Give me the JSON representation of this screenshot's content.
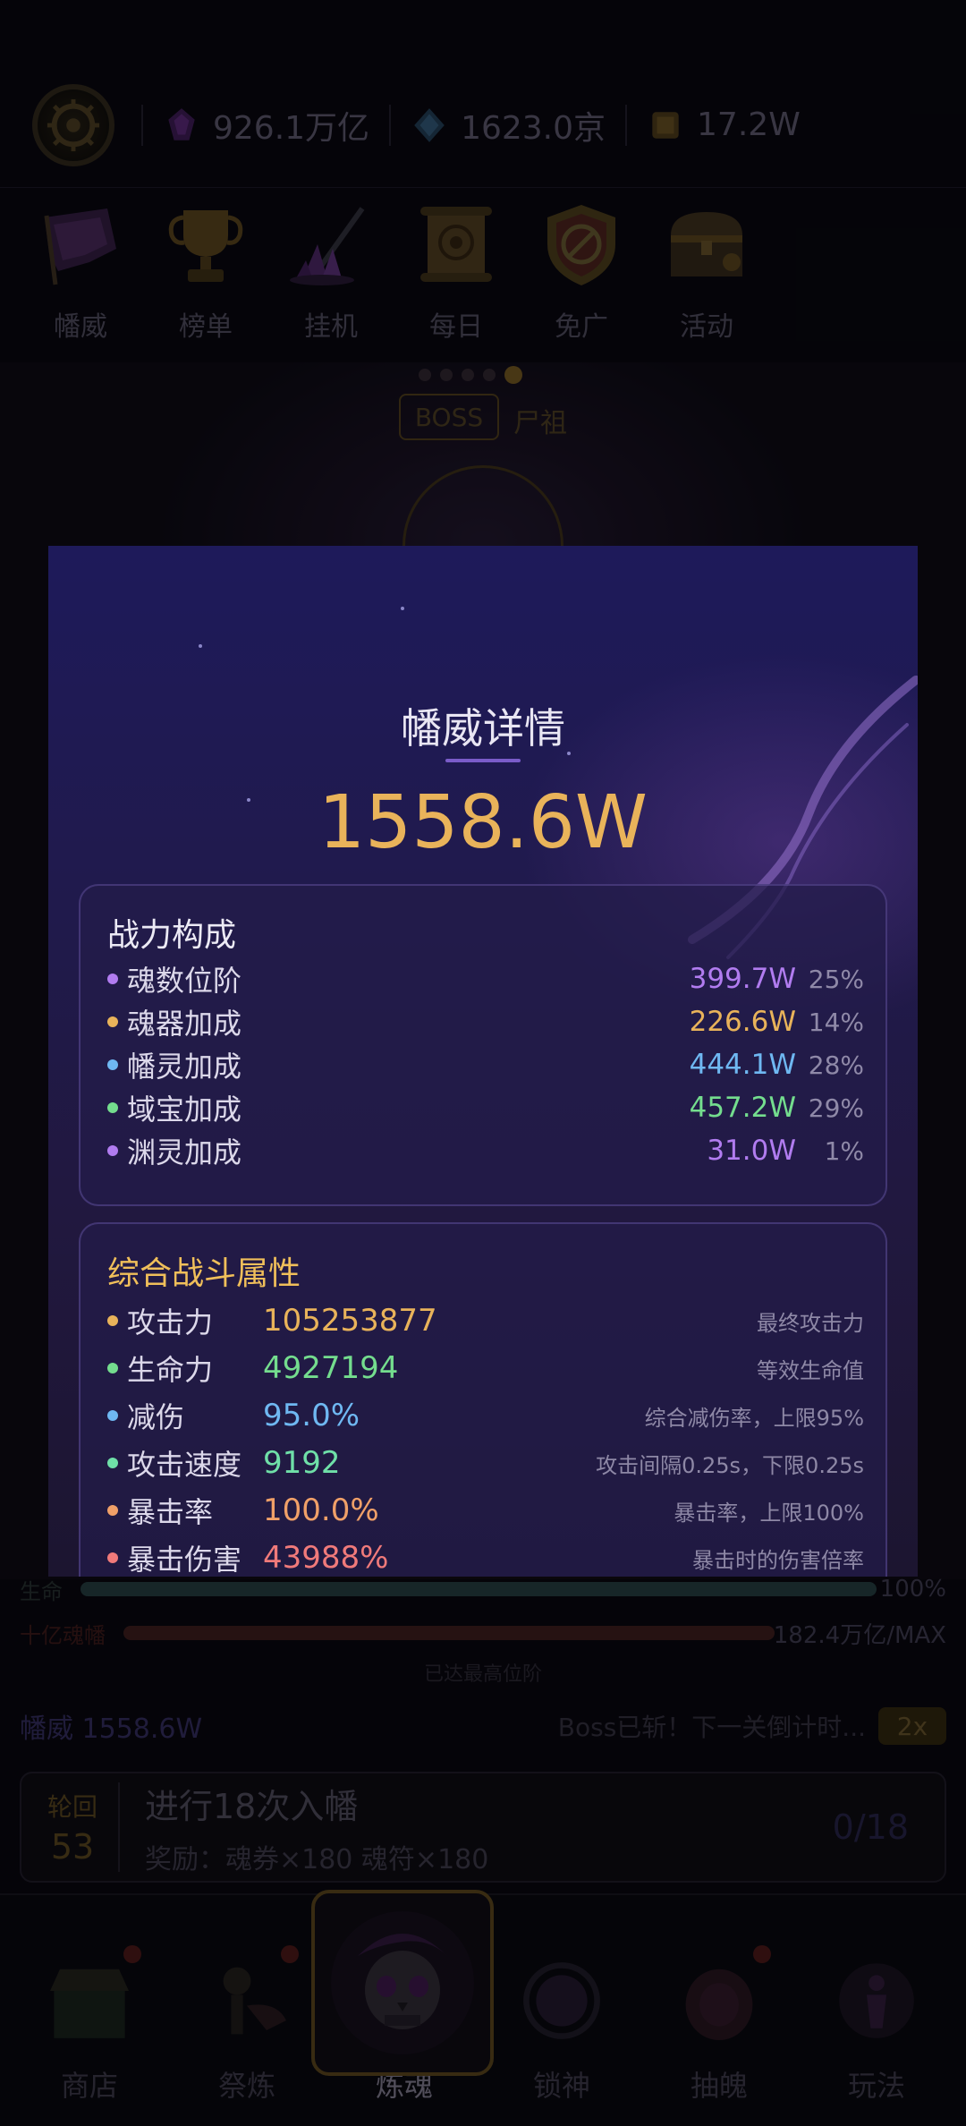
{
  "topbar": {
    "resources": [
      {
        "icon": "soul-gem-icon",
        "value": "926.1万亿"
      },
      {
        "icon": "blue-crystal-icon",
        "value": "1623.0京"
      },
      {
        "icon": "scroll-coin-icon",
        "value": "17.2W"
      }
    ]
  },
  "categories": [
    {
      "label": "幡威",
      "icon": "banner-icon"
    },
    {
      "label": "榜单",
      "icon": "trophy-icon"
    },
    {
      "label": "挂机",
      "icon": "crystal-sword-icon"
    },
    {
      "label": "每日",
      "icon": "scroll-icon"
    },
    {
      "label": "免广",
      "icon": "no-ads-shield-icon"
    },
    {
      "label": "活动",
      "icon": "treasure-chest-icon"
    }
  ],
  "boss": {
    "tag": "BOSS",
    "name": "尸祖"
  },
  "bars": {
    "hp_label": "生命",
    "hp_value": "100%",
    "banner_label": "十亿魂幡",
    "banner_value": "182.4万亿/MAX",
    "max_note": "已达最高位阶"
  },
  "status": {
    "left": "幡威 1558.6W",
    "right": "Boss已斩！下一关倒计时...",
    "speed": "2x"
  },
  "quest": {
    "round_label": "轮回",
    "round_number": "53",
    "title": "进行18次入幡",
    "reward": "奖励：魂券×180 魂符×180",
    "progress": "0/18"
  },
  "nav": [
    {
      "label": "商店",
      "icon": "shop-icon",
      "dot": true
    },
    {
      "label": "祭炼",
      "icon": "skeleton-icon",
      "dot": true
    },
    {
      "label": "炼魂",
      "icon": "skull-vortex-icon",
      "dot": false,
      "active": true
    },
    {
      "label": "锁神",
      "icon": "chain-orb-icon",
      "dot": false
    },
    {
      "label": "抽魄",
      "icon": "portal-icon",
      "dot": true
    },
    {
      "label": "玩法",
      "icon": "spirit-figure-icon",
      "dot": false
    }
  ],
  "modal": {
    "title": "幡威详情",
    "total": "1558.6W",
    "composition": {
      "title": "战力构成",
      "rows": [
        {
          "label": "魂数位阶",
          "amount": "399.7W",
          "pct": "25%",
          "color": "#b17cf0"
        },
        {
          "label": "魂器加成",
          "amount": "226.6W",
          "pct": "14%",
          "color": "#e9b35a"
        },
        {
          "label": "幡灵加成",
          "amount": "444.1W",
          "pct": "28%",
          "color": "#6fb8f2"
        },
        {
          "label": "域宝加成",
          "amount": "457.2W",
          "pct": "29%",
          "color": "#74dd8e"
        },
        {
          "label": "渊灵加成",
          "amount": "31.0W",
          "pct": "1%",
          "color": "#b17cf0"
        }
      ]
    },
    "combat": {
      "title": "综合战斗属性",
      "rows": [
        {
          "label": "攻击力",
          "value": "105253877",
          "desc": "最终攻击力",
          "color": "#e9b35a"
        },
        {
          "label": "生命力",
          "value": "4927194",
          "desc": "等效生命值",
          "color": "#74dd8e"
        },
        {
          "label": "减伤",
          "value": "95.0%",
          "desc": "综合减伤率，上限95%",
          "color": "#6fb8f2"
        },
        {
          "label": "攻击速度",
          "value": "9192",
          "desc": "攻击间隔0.25s，下限0.25s",
          "color": "#6fe0a8"
        },
        {
          "label": "暴击率",
          "value": "100.0%",
          "desc": "暴击率，上限100%",
          "color": "#f0a068"
        },
        {
          "label": "暴击伤害",
          "value": "43988%",
          "desc": "暴击时的伤害倍率",
          "color": "#f07a7a"
        }
      ]
    }
  }
}
